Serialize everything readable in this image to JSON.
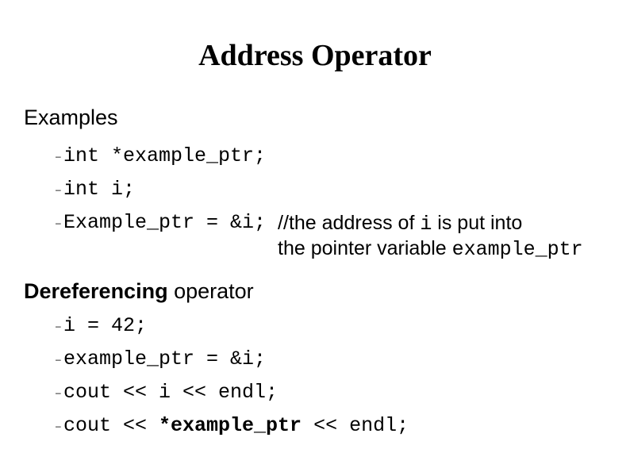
{
  "title": "Address Operator",
  "sectionA": {
    "heading": "Examples",
    "line1": "int *example_ptr;",
    "line2": "int i;",
    "line3_code": "Example_ptr = &i; ",
    "line3_comment_prefix": "//",
    "line3_comment_a1": "the address of ",
    "line3_comment_a2_mono": "i",
    "line3_comment_a3": " is put into",
    "line3_comment_b1": "the pointer variable ",
    "line3_comment_b2_mono": "example_ptr"
  },
  "sectionB": {
    "heading_bold": "Dereferencing",
    "heading_rest": " operator",
    "line1": "i = 42;",
    "line2": "example_ptr = &i;",
    "line3": "cout << i << endl;",
    "line4_a": "cout << ",
    "line4_b_bold": "*example_ptr",
    "line4_c": " << endl;"
  },
  "glyphs": {
    "dash": "–"
  }
}
